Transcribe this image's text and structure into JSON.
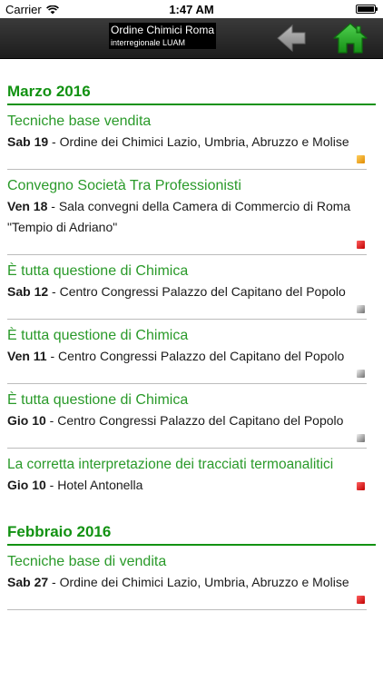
{
  "status_bar": {
    "carrier": "Carrier",
    "time": "1:47 AM"
  },
  "nav": {
    "title_line1": "Ordine Chimici Roma",
    "title_line2": "interregionale LUAM",
    "back_icon": "back-arrow-icon",
    "home_icon": "home-icon",
    "home_color": "#1e9e1e",
    "back_color": "#9a9a9a"
  },
  "colors": {
    "accent_green": "#129212",
    "indicator_orange": "#f0a020",
    "indicator_red": "#d81818",
    "indicator_gray": "#8a8a8a"
  },
  "sections": [
    {
      "month": "Marzo 2016",
      "events": [
        {
          "title": "Tecniche base vendita",
          "day": "Sab 19",
          "place": "Ordine dei Chimici Lazio, Umbria, Abruzzo e Molise",
          "indicator": "orange"
        },
        {
          "title": "Convegno Società Tra Professionisti",
          "day": "Ven 18",
          "place": "Sala convegni della Camera di Commercio di Roma \"Tempio di Adriano\"",
          "indicator": "red"
        },
        {
          "title": "È tutta questione di Chimica",
          "day": "Sab 12",
          "place": "Centro Congressi Palazzo del Capitano del Popolo",
          "indicator": "gray"
        },
        {
          "title": "È tutta questione di Chimica",
          "day": "Ven 11",
          "place": "Centro Congressi Palazzo del Capitano del Popolo",
          "indicator": "gray"
        },
        {
          "title": "È tutta questione di Chimica",
          "day": "Gio 10",
          "place": "Centro Congressi Palazzo del Capitano del Popolo",
          "indicator": "gray"
        },
        {
          "title": "La corretta interpretazione dei tracciati termoanalitici",
          "day": "Gio 10",
          "place": "Hotel Antonella",
          "indicator": "red"
        }
      ]
    },
    {
      "month": "Febbraio 2016",
      "events": [
        {
          "title": "Tecniche base di vendita",
          "day": "Sab 27",
          "place": "Ordine dei Chimici Lazio, Umbria, Abruzzo e Molise",
          "indicator": "red"
        }
      ]
    }
  ]
}
